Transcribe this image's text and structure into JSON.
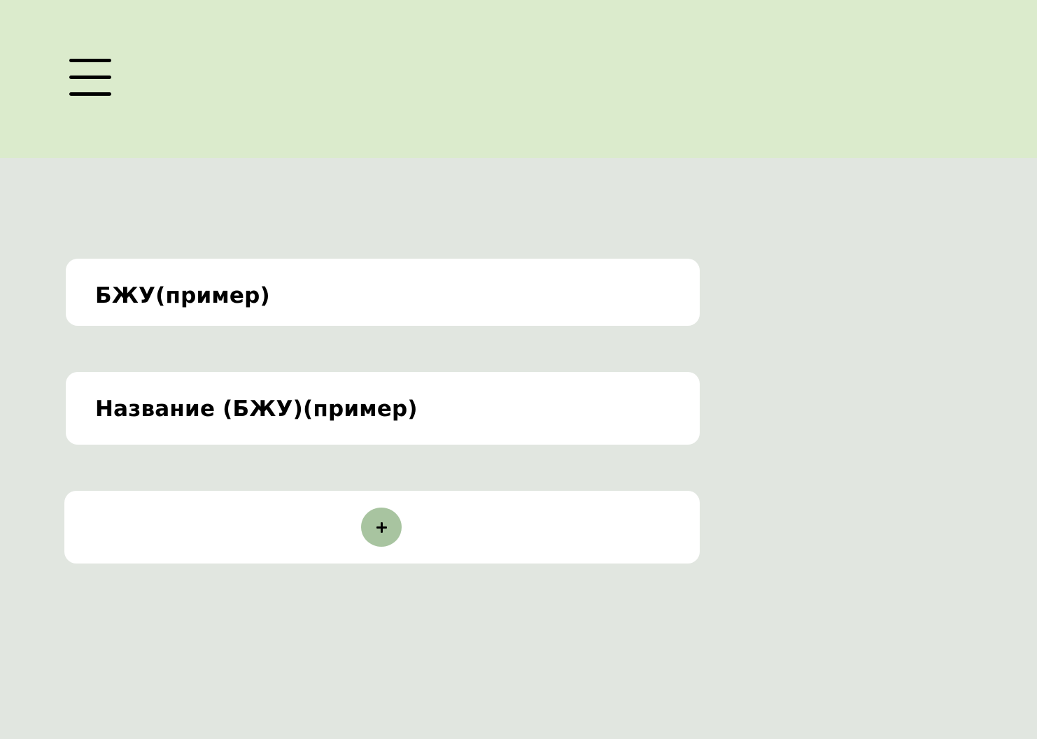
{
  "header": {
    "menu_icon": "hamburger-menu-icon",
    "background_color": "#dbebcc"
  },
  "page": {
    "background_color": "#e1e6e0"
  },
  "cards": [
    {
      "label": "БЖУ(пример)"
    },
    {
      "label": "Название (БЖУ)(пример)"
    }
  ],
  "add_card": {
    "icon": "plus-icon",
    "button_color": "#a8c4a0"
  }
}
